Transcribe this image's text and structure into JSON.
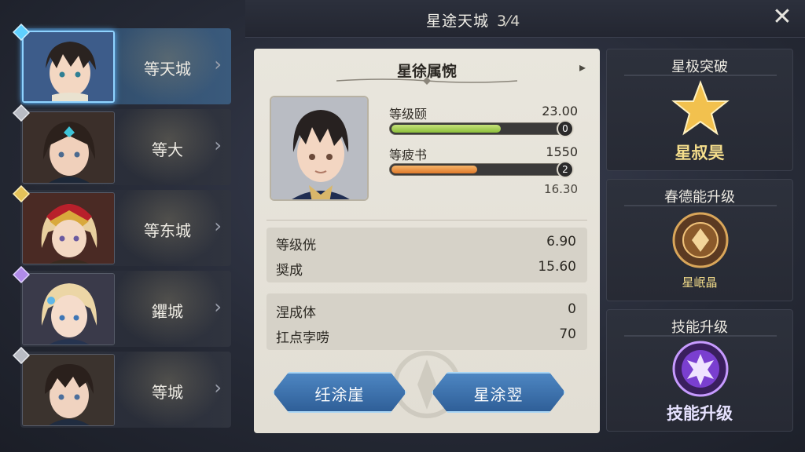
{
  "header": {
    "title": "星途天城",
    "title_extra": "3⁄4",
    "close_label": "✕"
  },
  "roster": [
    {
      "name": "等天城",
      "active": true,
      "gem_color": "#5fd0ff"
    },
    {
      "name": "等大",
      "active": false,
      "gem_color": "#b9bcc4"
    },
    {
      "name": "等东城",
      "active": false,
      "gem_color": "#e5c25a"
    },
    {
      "name": "鑺城",
      "active": false,
      "gem_color": "#b08be8"
    },
    {
      "name": "等城",
      "active": false,
      "gem_color": "#b9bcc4"
    }
  ],
  "roster_chevron": "›",
  "detail": {
    "title": "星徐属惋",
    "nav_arrow": "▸",
    "bar1": {
      "label": "等级颐",
      "value": "23.00",
      "knob": "0",
      "fill_fraction": 0.66
    },
    "bar2": {
      "label": "等疲书",
      "value": "1550",
      "knob": "2",
      "fill_fraction": 0.52,
      "sub_value": "16.30"
    },
    "stats_a": [
      {
        "label": "等级侊",
        "value": "6.90"
      },
      {
        "label": "奨成",
        "value": "15.60"
      }
    ],
    "stats_b": [
      {
        "label": "涅成体",
        "value": "0"
      },
      {
        "label": "扛点孛唠",
        "value": "70"
      }
    ],
    "button_left": "纴涂崖",
    "button_right": "星涂翌"
  },
  "right": {
    "card1": {
      "title": "星极突破",
      "label": "星叔昊"
    },
    "card2": {
      "title": "春德能升级",
      "label": "星岷晶"
    },
    "card3": {
      "title": "技能升级",
      "label": "技能升级"
    }
  },
  "colors": {
    "accent_blue": "#4d86c2",
    "bar_green": "#8cbf3b",
    "bar_orange": "#e07a2a",
    "gold": "#f4dd8b"
  }
}
